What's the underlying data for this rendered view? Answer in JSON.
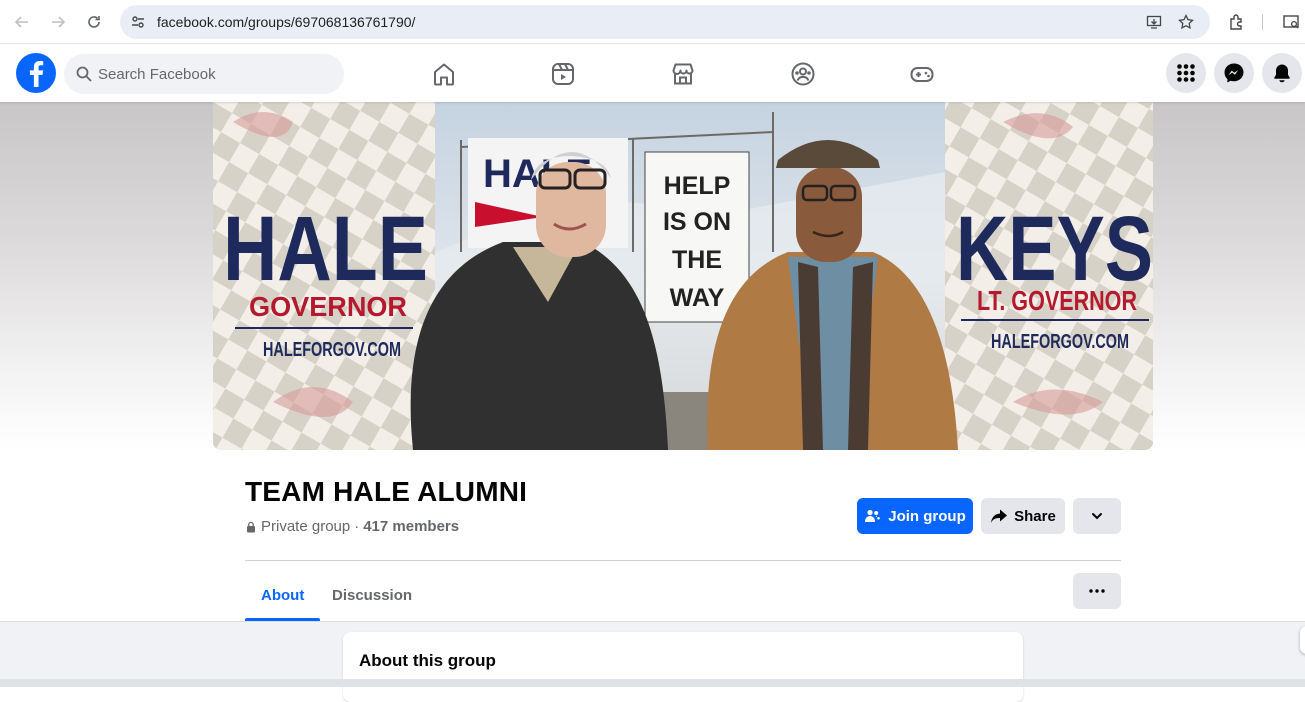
{
  "browser": {
    "url": "facebook.com/groups/697068136761790/",
    "icons": [
      "back-arrow-icon",
      "forward-arrow-icon",
      "reload-icon",
      "site-info-icon",
      "install-app-icon",
      "star-icon",
      "extensions-icon",
      "side-panel-icon"
    ]
  },
  "header": {
    "search_placeholder": "Search Facebook",
    "nav_icons": [
      "home-icon",
      "video-icon",
      "marketplace-icon",
      "groups-icon",
      "gaming-icon"
    ],
    "right_icons": [
      "menu-grid-icon",
      "messenger-icon",
      "notifications-icon"
    ]
  },
  "cover": {
    "left_name": "HALE",
    "left_title": "GOVERNOR",
    "left_site": "HALEFORGOV.COM",
    "right_name": "KEYS",
    "right_title": "LT. GOVERNOR",
    "right_site": "HALEFORGOV.COM",
    "sign_lines": [
      "HELP",
      "IS ON",
      "THE",
      "WAY"
    ],
    "bg_sign_text": "HALE"
  },
  "group": {
    "name": "TEAM HALE ALUMNI",
    "privacy": "Private group",
    "separator": "·",
    "members": "417 members",
    "join_label": "Join group",
    "share_label": "Share"
  },
  "tabs": [
    {
      "label": "About",
      "active": true
    },
    {
      "label": "Discussion",
      "active": false
    }
  ],
  "about": {
    "title": "About this group"
  },
  "colors": {
    "brand": "#0866ff",
    "text": "#050505",
    "secondary_text": "#65676b",
    "button_gray": "#e4e6eb",
    "page_bg": "#f0f2f5"
  }
}
